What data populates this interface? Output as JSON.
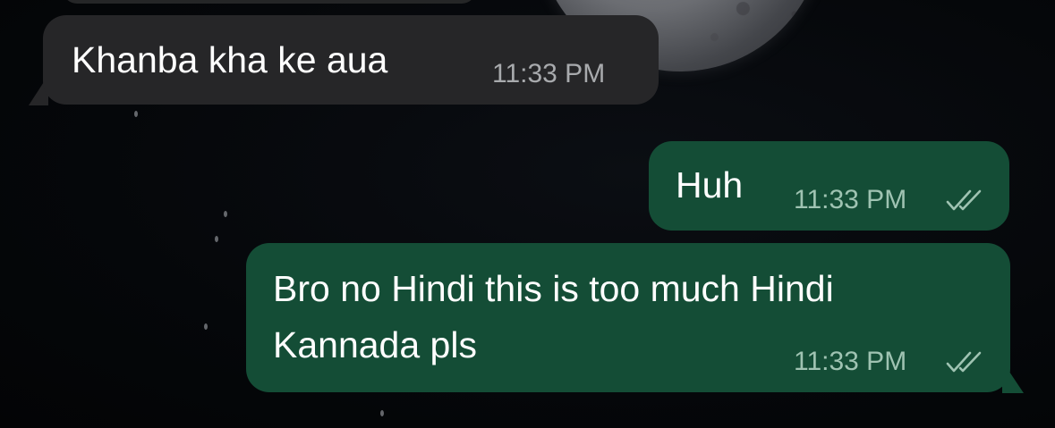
{
  "conversation": {
    "messages": [
      {
        "direction": "incoming",
        "lines": [
          "Khanba kha ke aua"
        ],
        "time": "11:33 PM"
      },
      {
        "direction": "outgoing",
        "lines": [
          "Huh"
        ],
        "time": "11:33 PM",
        "status": "read-double-check-icon"
      },
      {
        "direction": "outgoing",
        "lines": [
          "Bro no Hindi this is too much Hindi",
          "Kannada pls"
        ],
        "time": "11:33 PM",
        "status": "read-double-check-icon"
      }
    ]
  },
  "colors": {
    "incoming_bubble": "#262628",
    "outgoing_bubble": "#144d36",
    "background": "#050608",
    "timestamp_outgoing": "#9fc3b2",
    "timestamp_incoming": "#a8aaad"
  }
}
